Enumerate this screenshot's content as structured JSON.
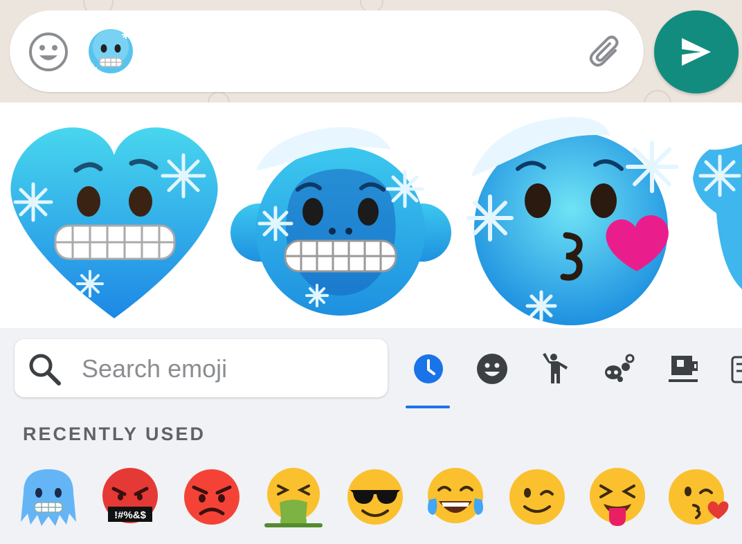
{
  "compose": {
    "typed_emoji": "cold-face-emoji",
    "smiley_icon": "smiley-face-icon",
    "attach_icon": "paperclip-icon",
    "send_icon": "send-arrow-icon",
    "send_color": "#128c7e"
  },
  "stickers": [
    {
      "name": "frozen-heart-sticker"
    },
    {
      "name": "frozen-monkey-sticker"
    },
    {
      "name": "frozen-kissing-face-sticker"
    },
    {
      "name": "frozen-partial-sticker"
    }
  ],
  "search": {
    "placeholder": "Search emoji",
    "icon": "search-icon"
  },
  "categories": [
    {
      "name": "recent-clock",
      "selected": true
    },
    {
      "name": "smileys"
    },
    {
      "name": "people"
    },
    {
      "name": "animals-nature"
    },
    {
      "name": "food-drink"
    },
    {
      "name": "travel"
    }
  ],
  "recent": {
    "title": "RECENTLY USED",
    "items": [
      {
        "name": "cold-face",
        "color": "#6ec6ff"
      },
      {
        "name": "face-with-symbols-on-mouth",
        "color": "#e53935",
        "text": "!#%&$"
      },
      {
        "name": "angry-face",
        "color": "#f44336"
      },
      {
        "name": "vomiting-face",
        "color": "#fbc02d"
      },
      {
        "name": "smiling-face-with-sunglasses",
        "color": "#fbc02d"
      },
      {
        "name": "face-with-tears-of-joy",
        "color": "#fbc02d"
      },
      {
        "name": "winking-face",
        "color": "#fbc02d"
      },
      {
        "name": "squinting-face-with-tongue",
        "color": "#fbc02d"
      },
      {
        "name": "face-blowing-a-kiss",
        "color": "#fbc02d"
      }
    ]
  }
}
